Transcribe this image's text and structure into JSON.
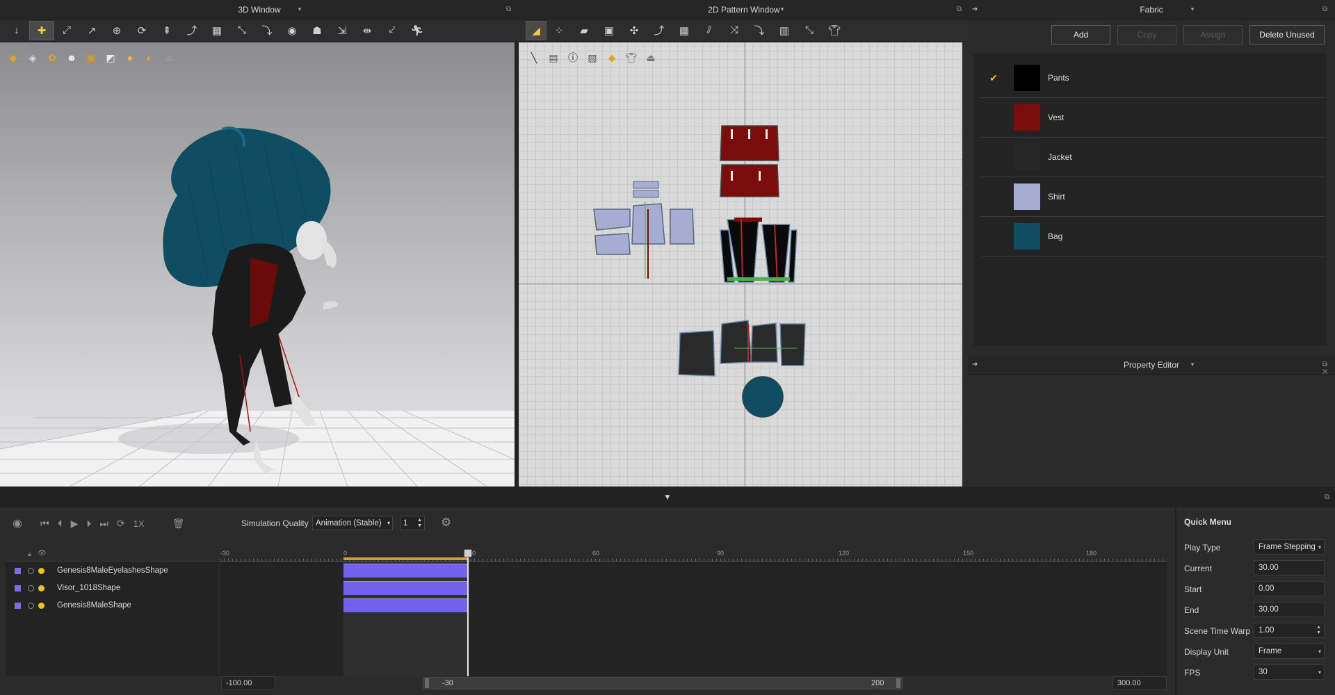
{
  "panels": {
    "window_3d": "3D Window",
    "window_2d": "2D Pattern Window",
    "fabric": "Fabric",
    "property_editor": "Property Editor"
  },
  "fabric": {
    "buttons": {
      "add": "Add",
      "copy": "Copy",
      "assign": "Assign",
      "delete_unused": "Delete Unused"
    },
    "items": [
      {
        "name": "Pants",
        "color": "#000000",
        "selected": true
      },
      {
        "name": "Vest",
        "color": "#7a0c0c",
        "selected": false
      },
      {
        "name": "Jacket",
        "color": "#262626",
        "selected": false
      },
      {
        "name": "Shirt",
        "color": "#a6acd2",
        "selected": false
      },
      {
        "name": "Bag",
        "color": "#0f4d62",
        "selected": false
      }
    ]
  },
  "timeline": {
    "speed": "1X",
    "sim_quality_label": "Simulation Quality",
    "sim_quality_value": "Animation (Stable)",
    "sim_quality_count": "1",
    "ticks": [
      "-30",
      "0",
      "30",
      "60",
      "90",
      "120",
      "150",
      "180"
    ],
    "layers": [
      "Genesis8MaleEyelashesShape",
      "Visor_1018Shape",
      "Genesis8MaleShape"
    ],
    "range_start": "-100.00",
    "scroll_left": "-30",
    "scroll_right": "200",
    "range_end": "300.00"
  },
  "quick_menu": {
    "title": "Quick Menu",
    "play_type_label": "Play Type",
    "play_type_value": "Frame Stepping",
    "current_label": "Current",
    "current_value": "30.00",
    "start_label": "Start",
    "start_value": "0.00",
    "end_label": "End",
    "end_value": "30.00",
    "warp_label": "Scene Time Warp",
    "warp_value": "1.00",
    "unit_label": "Display Unit",
    "unit_value": "Frame",
    "fps_label": "FPS",
    "fps_value": "30"
  },
  "colors": {
    "accent_yellow": "#f2c84a",
    "timeline_bar": "#7262ec",
    "bag_teal": "#0f4d62",
    "vest_red": "#7a0c0c",
    "shirt_lilac": "#a6acd2"
  }
}
